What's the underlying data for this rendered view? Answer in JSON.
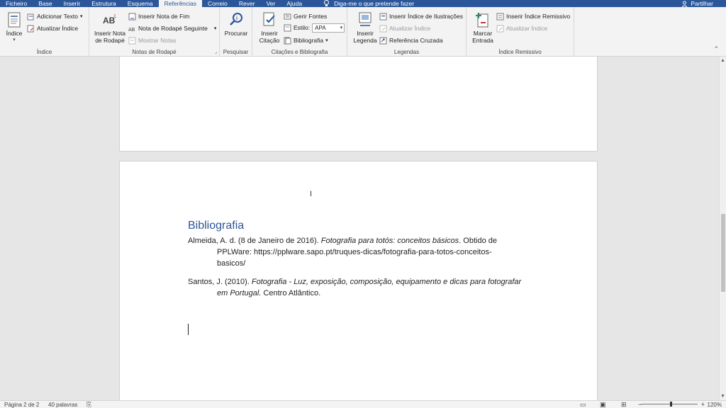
{
  "tabs": [
    "Ficheiro",
    "Base",
    "Inserir",
    "Estrutura",
    "Esquema",
    "Referências",
    "Correio",
    "Rever",
    "Ver",
    "Ajuda"
  ],
  "active_tab": "Referências",
  "tell_me": "Diga-me o que pretende fazer",
  "share": "Partilhar",
  "ribbon": {
    "indice": {
      "label": "Índice",
      "big_button": "Índice",
      "add_text": "Adicionar Texto",
      "update_index": "Atualizar Índice"
    },
    "notas": {
      "label": "Notas de Rodapé",
      "big_button_line1": "Inserir Nota",
      "big_button_line2": "de Rodapé",
      "insert_endnote": "Inserir Nota de Fim",
      "next_footnote": "Nota de Rodapé Seguinte",
      "show_notes": "Mostrar Notas",
      "ab_icon_text": "AB"
    },
    "pesquisar": {
      "label": "Pesquisar",
      "big_button": "Procurar"
    },
    "citacoes": {
      "label": "Citações e Bibliografia",
      "big_button_line1": "Inserir",
      "big_button_line2": "Citação",
      "manage_sources": "Gerir Fontes",
      "style_label": "Estilo:",
      "style_value": "APA",
      "bibliography": "Bibliografia"
    },
    "legendas": {
      "label": "Legendas",
      "big_button_line1": "Inserir",
      "big_button_line2": "Legenda",
      "insert_table_of_figures": "Inserir Índice de Ilustrações",
      "update_table": "Atualizar Índice",
      "cross_reference": "Referência Cruzada"
    },
    "remissivo": {
      "label": "Índice Remissivo",
      "big_button_line1": "Marcar",
      "big_button_line2": "Entrada",
      "insert_index": "Inserir Índice Remissivo",
      "update_index": "Atualizar Índice"
    }
  },
  "document": {
    "heading": "Bibliografia",
    "ref1": {
      "part1": "Almeida, A. d. (8 de Janeiro de 2016). ",
      "title": "Fotografia para totós: conceitos básicos",
      "part2": ". Obtido de",
      "line2": "PPLWare: https://pplware.sapo.pt/truques-dicas/fotografia-para-totos-conceitos-",
      "line3": "basicos/"
    },
    "ref2": {
      "part1": "Santos, J. (2010). ",
      "title_line1": "Fotografia - Luz, exposição, composição, equipamento e dicas para fotografar",
      "title_line2": "em Portugal.",
      "part2": " Centro Atlântico."
    }
  },
  "status": {
    "page": "Página 2 de 2",
    "words": "40 palavras",
    "zoom": "120%"
  },
  "colors": {
    "accent": "#2b579a",
    "heading": "#2e5597"
  }
}
